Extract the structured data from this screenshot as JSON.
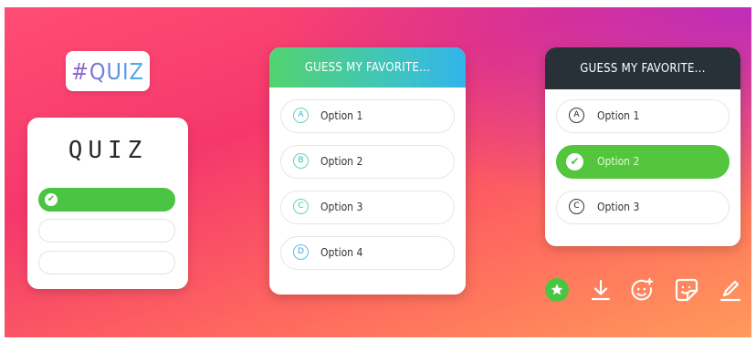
{
  "hashtag": {
    "text": "#QUIZ"
  },
  "mini_card": {
    "title": "QUIZ"
  },
  "card_gradient": {
    "header": "GUESS MY FAVORITE...",
    "options": [
      {
        "letter": "A",
        "label": "Option 1"
      },
      {
        "letter": "B",
        "label": "Option 2"
      },
      {
        "letter": "C",
        "label": "Option 3"
      },
      {
        "letter": "D",
        "label": "Option 4"
      }
    ]
  },
  "card_dark": {
    "header": "GUESS MY FAVORITE...",
    "options": [
      {
        "letter": "A",
        "label": "Option 1",
        "correct": false
      },
      {
        "letter": "",
        "label": "Option 2",
        "correct": true
      },
      {
        "letter": "C",
        "label": "Option 3",
        "correct": false
      }
    ]
  },
  "toolbar": {
    "icons": [
      "star-badge-icon",
      "download-icon",
      "face-effects-icon",
      "sticker-icon",
      "draw-pen-icon"
    ]
  },
  "colors": {
    "correct_green": "#4cc443",
    "dark_header": "#283138",
    "gradient_header_start": "#52d36f",
    "gradient_header_end": "#31b4ea"
  }
}
